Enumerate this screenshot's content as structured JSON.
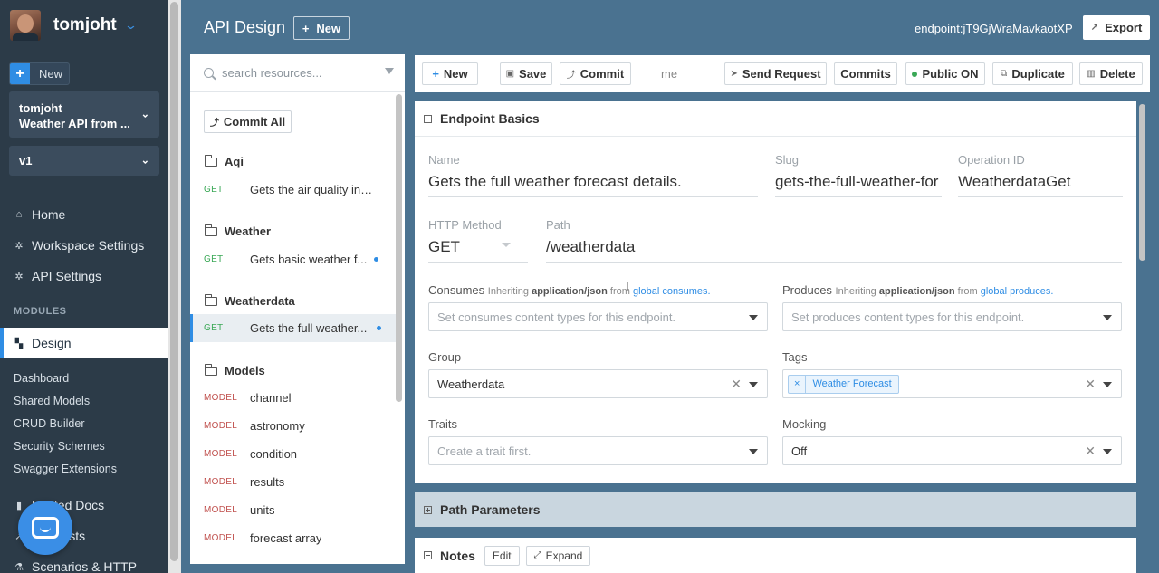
{
  "nav": {
    "username": "tomjoht",
    "new_label": "New",
    "workspace_line1": "tomjoht",
    "workspace_line2": "Weather API from ...",
    "version": "v1",
    "items": [
      {
        "label": "Home",
        "icon": "home-icon"
      },
      {
        "label": "Workspace Settings",
        "icon": "gear-icon"
      },
      {
        "label": "API Settings",
        "icon": "gear-icon"
      }
    ],
    "modules_label": "MODULES",
    "active_module": "Design",
    "sub_items": [
      "Dashboard",
      "Shared Models",
      "CRUD Builder",
      "Security Schemes",
      "Swagger Extensions"
    ],
    "more_items": [
      "Hosted Docs",
      "Requests",
      "Scenarios & HTTP"
    ],
    "more_items_visible": [
      "...sted Docs",
      "...equests",
      "Scenarios & HTTP"
    ]
  },
  "header": {
    "title": "API Design",
    "new_label": "New",
    "endpoint_id": "endpoint:jT9GjWraMavkaotXP",
    "export_label": "Export"
  },
  "resources": {
    "search_placeholder": "search resources...",
    "commit_all_label": "Commit All",
    "groups": [
      {
        "name": "Aqi",
        "rows": [
          {
            "method": "GET",
            "name": "Gets the air quality ind...",
            "dot": false,
            "selected": false
          }
        ]
      },
      {
        "name": "Weather",
        "rows": [
          {
            "method": "GET",
            "name": "Gets basic weather f...",
            "dot": true,
            "selected": false
          }
        ]
      },
      {
        "name": "Weatherdata",
        "rows": [
          {
            "method": "GET",
            "name": "Gets the full weather...",
            "dot": true,
            "selected": true
          }
        ]
      },
      {
        "name": "Models",
        "rows": [
          {
            "method": "MODEL",
            "name": "channel"
          },
          {
            "method": "MODEL",
            "name": "astronomy"
          },
          {
            "method": "MODEL",
            "name": "condition"
          },
          {
            "method": "MODEL",
            "name": "results"
          },
          {
            "method": "MODEL",
            "name": "units"
          },
          {
            "method": "MODEL",
            "name": "forecast array"
          }
        ]
      }
    ]
  },
  "toolbar": {
    "new_label": "New",
    "save_label": "Save",
    "commit_label": "Commit",
    "me_text": "me",
    "send_request_label": "Send Request",
    "commits_label": "Commits",
    "public_label": "Public ON",
    "duplicate_label": "Duplicate",
    "delete_label": "Delete"
  },
  "endpoint": {
    "section_title": "Endpoint Basics",
    "name_label": "Name",
    "name_value": "Gets the full weather forecast details.",
    "slug_label": "Slug",
    "slug_value": "gets-the-full-weather-for",
    "opid_label": "Operation ID",
    "opid_value": "WeatherdataGet",
    "method_label": "HTTP Method",
    "method_value": "GET",
    "path_label": "Path",
    "path_value": "/weatherdata",
    "consumes_label": "Consumes",
    "consumes_hint_pre": "Inheriting",
    "consumes_hint_type": "application/json",
    "consumes_hint_from": "from",
    "consumes_hint_link": "global consumes.",
    "consumes_placeholder": "Set consumes content types for this endpoint.",
    "produces_label": "Produces",
    "produces_hint_pre": "Inheriting",
    "produces_hint_type": "application/json",
    "produces_hint_from": "from",
    "produces_hint_link": "global produces.",
    "produces_placeholder": "Set produces content types for this endpoint.",
    "group_label": "Group",
    "group_value": "Weatherdata",
    "tags_label": "Tags",
    "tags": [
      "Weather Forecast"
    ],
    "traits_label": "Traits",
    "traits_placeholder": "Create a trait first.",
    "mocking_label": "Mocking",
    "mocking_value": "Off"
  },
  "sections": {
    "path_params_title": "Path Parameters",
    "notes_title": "Notes",
    "notes_edit": "Edit",
    "notes_expand": "Expand"
  },
  "colors": {
    "accent": "#2f8de4",
    "nav_bg": "#2c3b48",
    "page_bg": "#4a7290",
    "get": "#3aa856",
    "model": "#c0504d"
  }
}
